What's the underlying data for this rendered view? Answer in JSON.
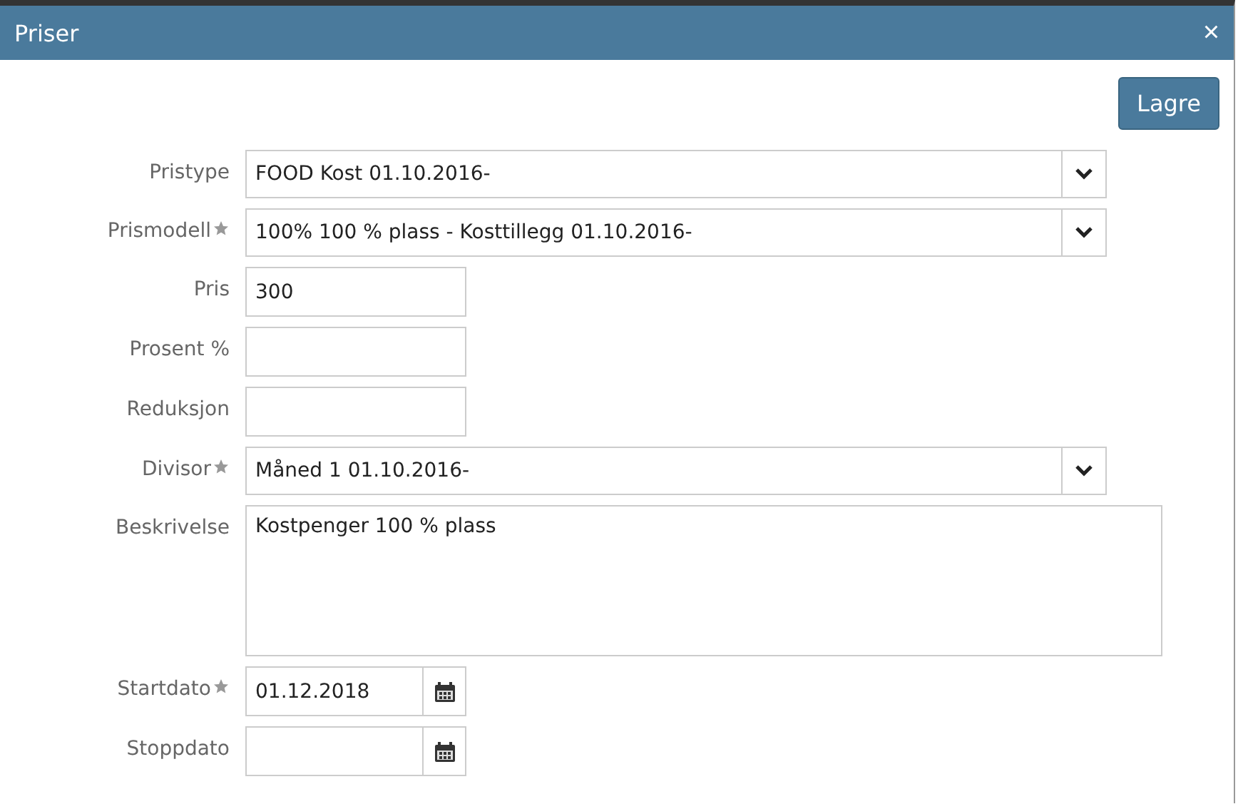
{
  "window": {
    "title": "Priser",
    "close": "×"
  },
  "save_button": "Lagre",
  "fields": [
    {
      "kind": "select",
      "label": "Pristype",
      "required": false,
      "value": "FOOD Kost 01.10.2016-"
    },
    {
      "kind": "select",
      "label": "Prismodell",
      "required": true,
      "value": "100% 100 % plass - Kosttillegg 01.10.2016-"
    },
    {
      "kind": "text",
      "label": "Pris",
      "required": false,
      "value": "300"
    },
    {
      "kind": "text",
      "label": "Prosent %",
      "required": false
    },
    {
      "kind": "text",
      "label": "Reduksjon",
      "required": false
    },
    {
      "kind": "select",
      "label": "Divisor",
      "required": true,
      "value": "Måned 1 01.10.2016-"
    },
    {
      "kind": "textarea",
      "label": "Beskrivelse",
      "required": false,
      "value": "Kostpenger 100 % plass"
    },
    {
      "kind": "date",
      "label": "Startdato",
      "required": true,
      "value": "01.12.2018"
    },
    {
      "kind": "date",
      "label": "Stoppdato",
      "required": false
    }
  ]
}
